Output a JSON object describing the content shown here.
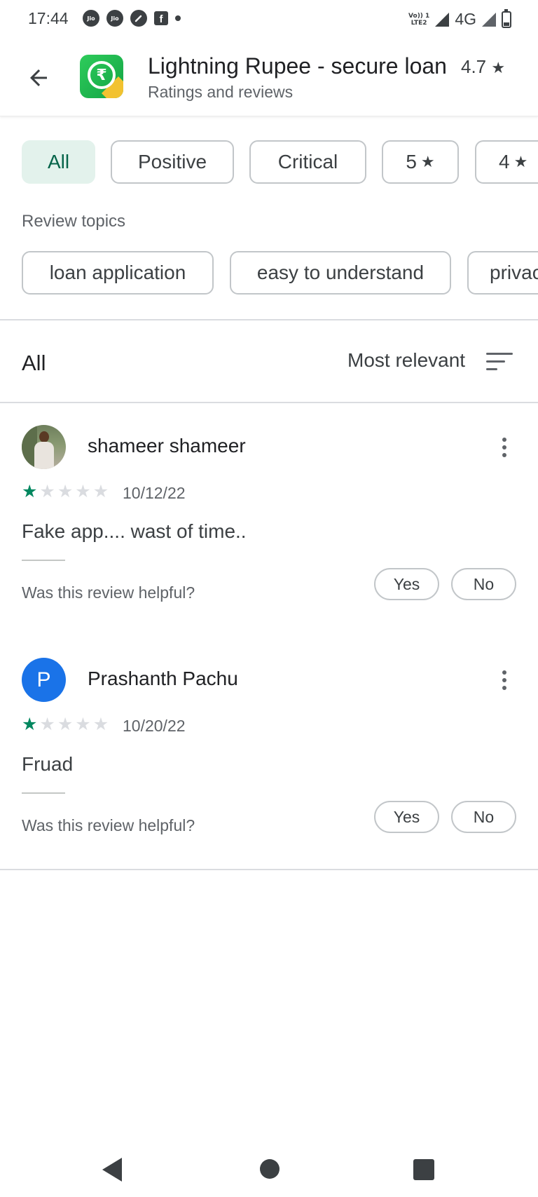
{
  "status_bar": {
    "time": "17:44",
    "carrier_1": "Jio",
    "carrier_2": "Jio",
    "volte_line1": "Vo)) 1",
    "volte_line2": "LTE2",
    "network": "4G",
    "left_icons": [
      "jio-icon",
      "jio-icon",
      "speed-icon",
      "facebook-icon",
      "dot-icon"
    ],
    "right_icons": [
      "volte-icon",
      "signal-icon",
      "signal-icon",
      "battery-icon"
    ]
  },
  "header": {
    "app_name": "Lightning Rupee - secure loan",
    "rating": "4.7",
    "rating_star": "★",
    "subtitle": "Ratings and reviews",
    "app_icon_glyph": "₹",
    "back_icon": "arrow-left-icon"
  },
  "filters": {
    "chips": [
      "All",
      "Positive",
      "Critical",
      "5",
      "4"
    ],
    "star": "★",
    "selected": "All",
    "selected_bg": "#e3f2ec",
    "selected_color": "#056449"
  },
  "topics": {
    "label": "Review topics",
    "chips": [
      "loan application",
      "easy to understand",
      "privac"
    ]
  },
  "list": {
    "title": "All",
    "sort_label": "Most relevant",
    "sort_icon": "sort-icon"
  },
  "reviews": [
    {
      "name": "shameer shameer",
      "avatar_type": "photo",
      "rating": 1,
      "max_rating": 5,
      "date": "10/12/22",
      "text": "Fake app.... wast of time..",
      "helpful_question": "Was this review helpful?",
      "yes_label": "Yes",
      "no_label": "No"
    },
    {
      "name": "Prashanth Pachu",
      "avatar_type": "letter",
      "avatar_letter": "P",
      "avatar_color": "#1a73e8",
      "rating": 1,
      "max_rating": 5,
      "date": "10/20/22",
      "text": "Fruad",
      "helpful_question": "Was this review helpful?",
      "yes_label": "Yes",
      "no_label": "No"
    }
  ],
  "colors": {
    "star_on": "#01875f",
    "star_off": "#dadce0",
    "divider": "#dadce0"
  },
  "nav_bar": {
    "icons": [
      "back-triangle-icon",
      "home-circle-icon",
      "recents-square-icon"
    ]
  }
}
